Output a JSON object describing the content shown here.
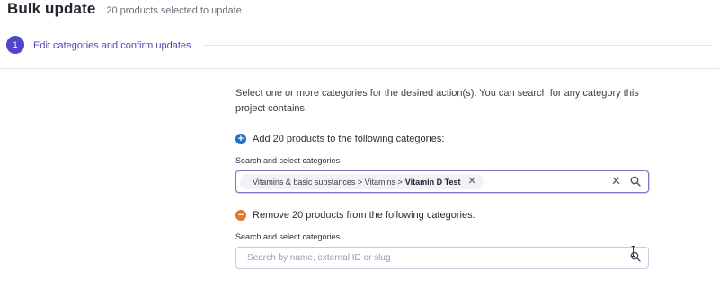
{
  "header": {
    "title": "Bulk update",
    "subtitle": "20 products selected to update"
  },
  "stepper": {
    "number": "1",
    "label": "Edit categories and confirm updates"
  },
  "intro": "Select one or more categories for the desired action(s). You can search for any category this project contains.",
  "add_section": {
    "icon": "plus-circle-icon",
    "heading": "Add 20 products to the following categories:",
    "field_label": "Search and select categories",
    "chip": {
      "path": "Vitamins & basic substances > Vitamins >",
      "leaf": "Vitamin D Test"
    }
  },
  "remove_section": {
    "icon": "minus-circle-icon",
    "heading": "Remove 20 products from the following categories:",
    "field_label": "Search and select categories",
    "placeholder": "Search by name, external ID or slug"
  },
  "colors": {
    "accent": "#4f46c8",
    "add": "#1d72c8",
    "remove": "#e0782a"
  }
}
